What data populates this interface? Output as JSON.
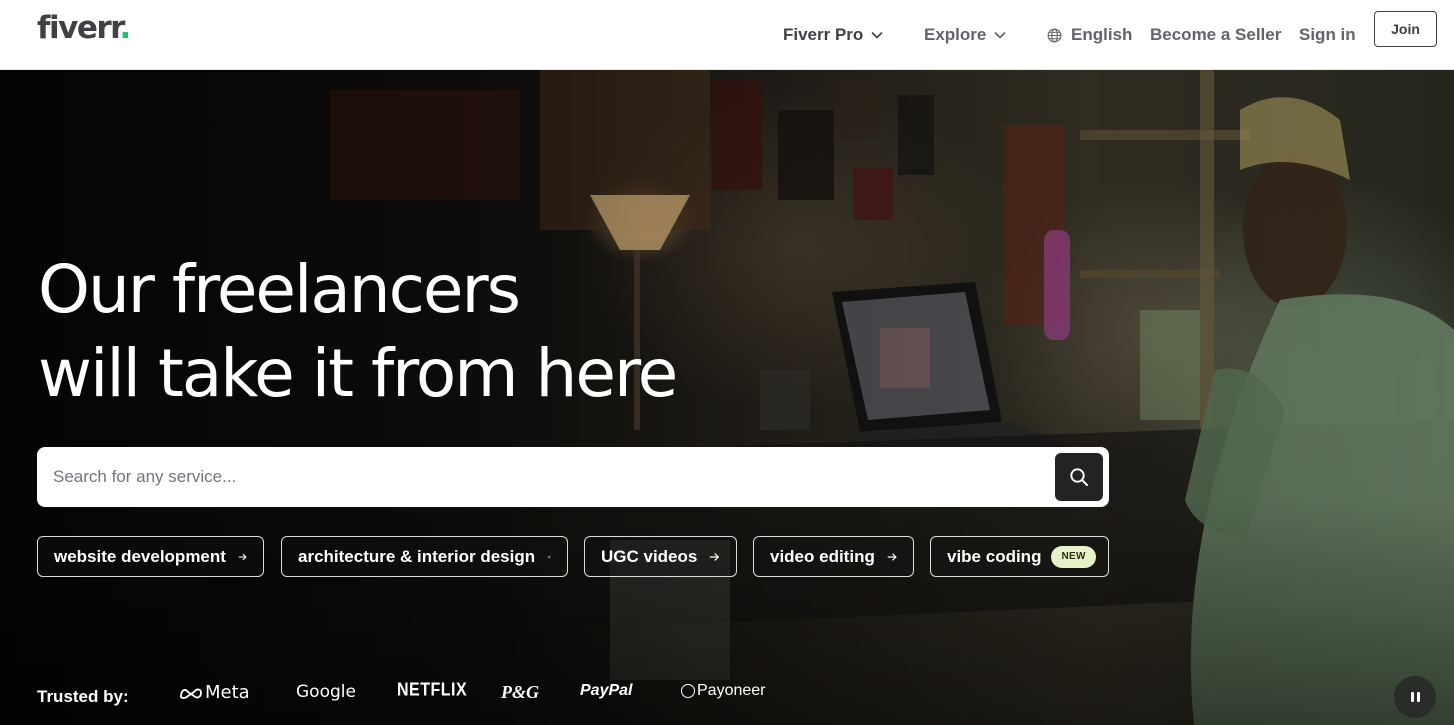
{
  "header": {
    "logo_text": "fiverr",
    "logo_dot": ".",
    "nav": {
      "fiverr_pro": "Fiverr Pro",
      "explore": "Explore",
      "language": "English",
      "become_seller": "Become a Seller",
      "sign_in": "Sign in",
      "join": "Join"
    }
  },
  "hero": {
    "headline_line1": "Our freelancers",
    "headline_line2": "will take it from here",
    "search": {
      "placeholder": "Search for any service...",
      "value": ""
    },
    "chips": [
      {
        "label": "website development",
        "badge": ""
      },
      {
        "label": "architecture & interior design",
        "badge": ""
      },
      {
        "label": "UGC videos",
        "badge": ""
      },
      {
        "label": "video editing",
        "badge": ""
      },
      {
        "label": "vibe coding",
        "badge": "NEW"
      }
    ],
    "trusted_label": "Trusted by:",
    "brands": [
      "Meta",
      "Google",
      "NETFLIX",
      "P&G",
      "PayPal",
      "Payoneer"
    ]
  },
  "colors": {
    "brand_green": "#1dbf73",
    "text_dark": "#404145",
    "text_muted": "#62646a",
    "search_button": "#222325",
    "new_badge_bg": "#e6f3c6"
  },
  "icons": {
    "nav_chevron": "chevron-down-icon",
    "language": "globe-icon",
    "search": "search-icon",
    "chip_arrow": "arrow-right-icon",
    "video_control": "pause-icon"
  }
}
